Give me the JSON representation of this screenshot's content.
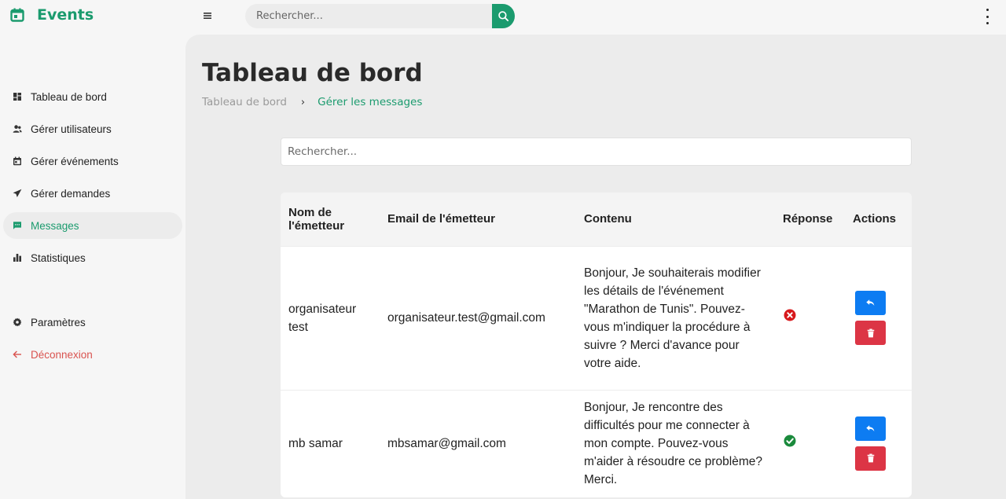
{
  "app": {
    "title": "Events"
  },
  "topbar": {
    "search_placeholder": "Rechercher..."
  },
  "sidebar": {
    "items": [
      {
        "label": "Tableau de bord",
        "icon": "dashboard-icon",
        "active": false
      },
      {
        "label": "Gérer utilisateurs",
        "icon": "users-icon",
        "active": false
      },
      {
        "label": "Gérer événements",
        "icon": "calendar-icon",
        "active": false
      },
      {
        "label": "Gérer demandes",
        "icon": "send-icon",
        "active": false
      },
      {
        "label": "Messages",
        "icon": "message-icon",
        "active": true
      },
      {
        "label": "Statistiques",
        "icon": "bar-chart-icon",
        "active": false
      }
    ],
    "settings_label": "Paramètres",
    "logout_label": "Déconnexion"
  },
  "main": {
    "page_title": "Tableau de bord",
    "breadcrumb": {
      "home": "Tableau de bord",
      "separator": "›",
      "current": "Gérer les messages"
    },
    "search_placeholder": "Rechercher...",
    "table": {
      "headers": [
        "Nom de l'émetteur",
        "Email de l'émetteur",
        "Contenu",
        "Réponse",
        "Actions"
      ],
      "rows": [
        {
          "name": "organisateur test",
          "email": "organisateur.test@gmail.com",
          "content": "Bonjour, Je souhaiterais modifier les détails de l'événement \"Marathon de Tunis\". Pouvez-vous m'indiquer la procédure à suivre ? Merci d'avance pour votre aide.",
          "replied": false
        },
        {
          "name": "mb samar",
          "email": "mbsamar@gmail.com",
          "content": "Bonjour, Je rencontre des difficultés pour me connecter à mon compte. Pouvez-vous m'aider à résoudre ce problème? Merci.",
          "replied": true
        }
      ]
    }
  },
  "colors": {
    "brand": "#1b9b6e",
    "reply_button": "#0d7cf2",
    "delete_button": "#dc3545",
    "status_no": "#d7191c",
    "status_yes": "#1a8a3c",
    "logout": "#d9534f"
  }
}
